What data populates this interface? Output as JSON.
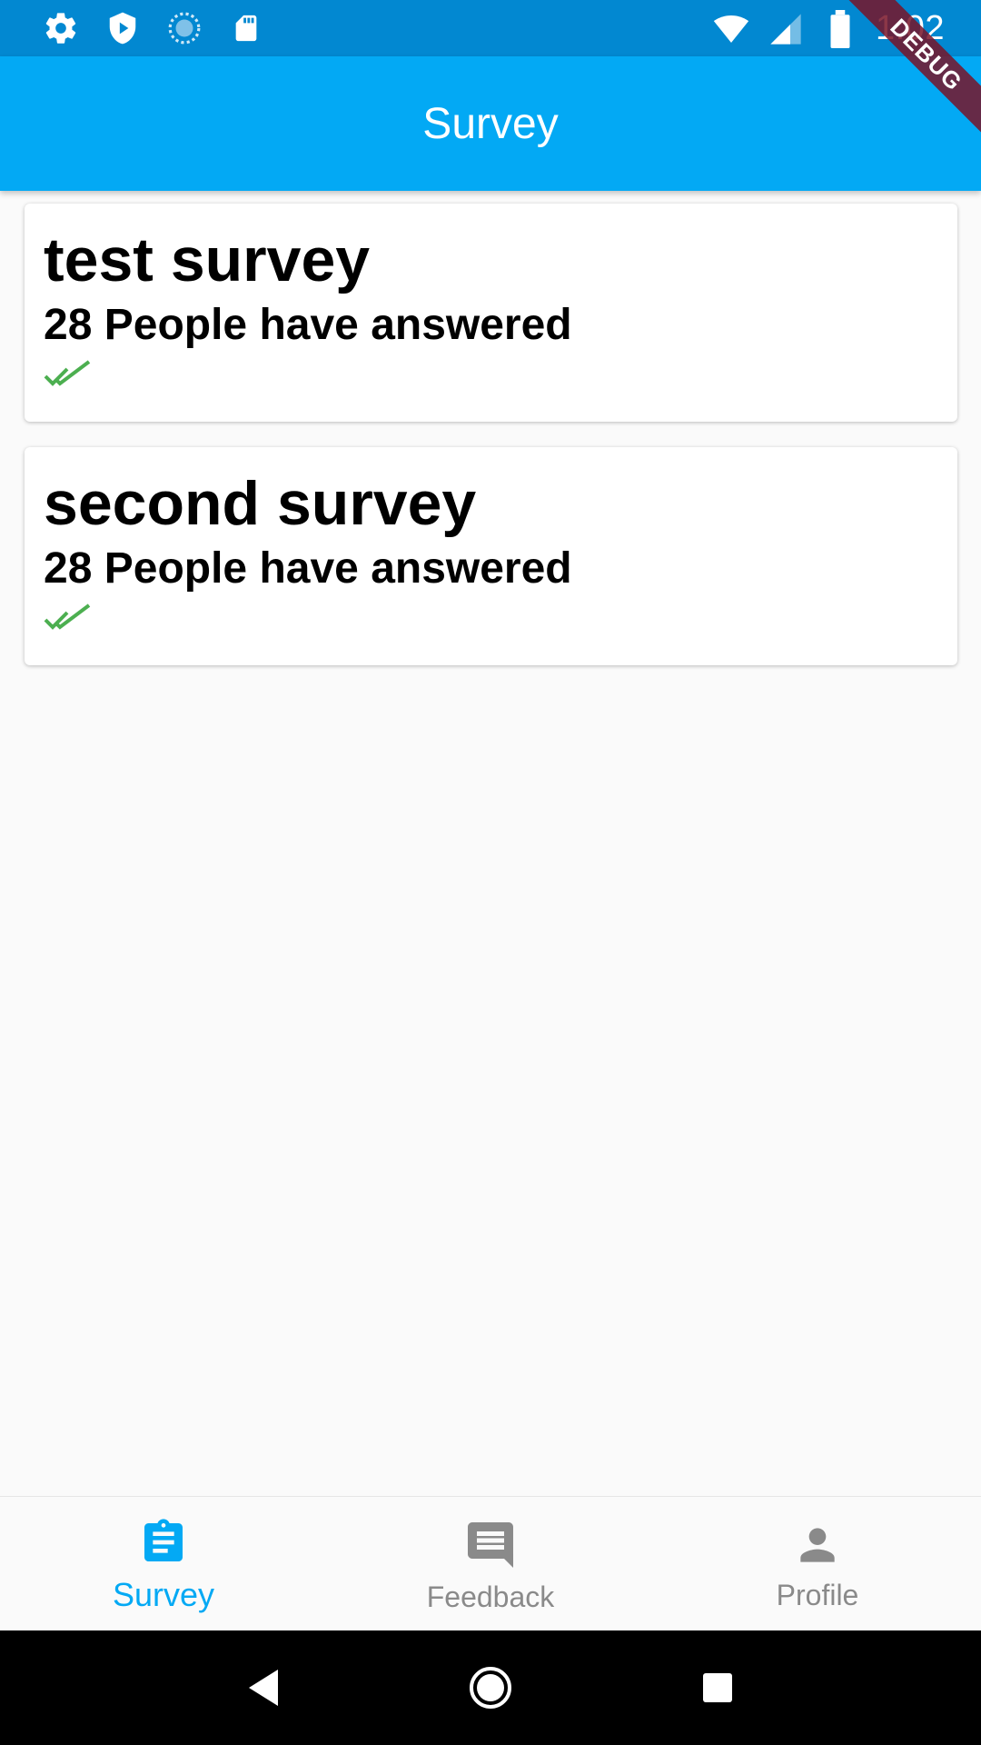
{
  "status_bar": {
    "time": "1:02",
    "icons": [
      "gear-icon",
      "shield-play-icon",
      "sync-icon",
      "sd-card-icon",
      "wifi-icon",
      "signal-icon",
      "battery-icon"
    ]
  },
  "debug_banner": "DEBUG",
  "app_bar": {
    "title": "Survey"
  },
  "surveys": [
    {
      "title": "test survey",
      "subtitle": "28 People have answered",
      "status_icon": "double-check-icon"
    },
    {
      "title": "second survey",
      "subtitle": "28 People have answered",
      "status_icon": "double-check-icon"
    }
  ],
  "bottom_nav": {
    "items": [
      {
        "label": "Survey",
        "icon": "assignment-icon",
        "active": true
      },
      {
        "label": "Feedback",
        "icon": "feedback-icon",
        "active": false
      },
      {
        "label": "Profile",
        "icon": "person-icon",
        "active": false
      }
    ]
  },
  "colors": {
    "status_bar": "#0288d1",
    "app_bar": "#03a9f4",
    "active": "#03a9f4",
    "inactive": "#8a8a8a",
    "check": "#4caf50"
  }
}
